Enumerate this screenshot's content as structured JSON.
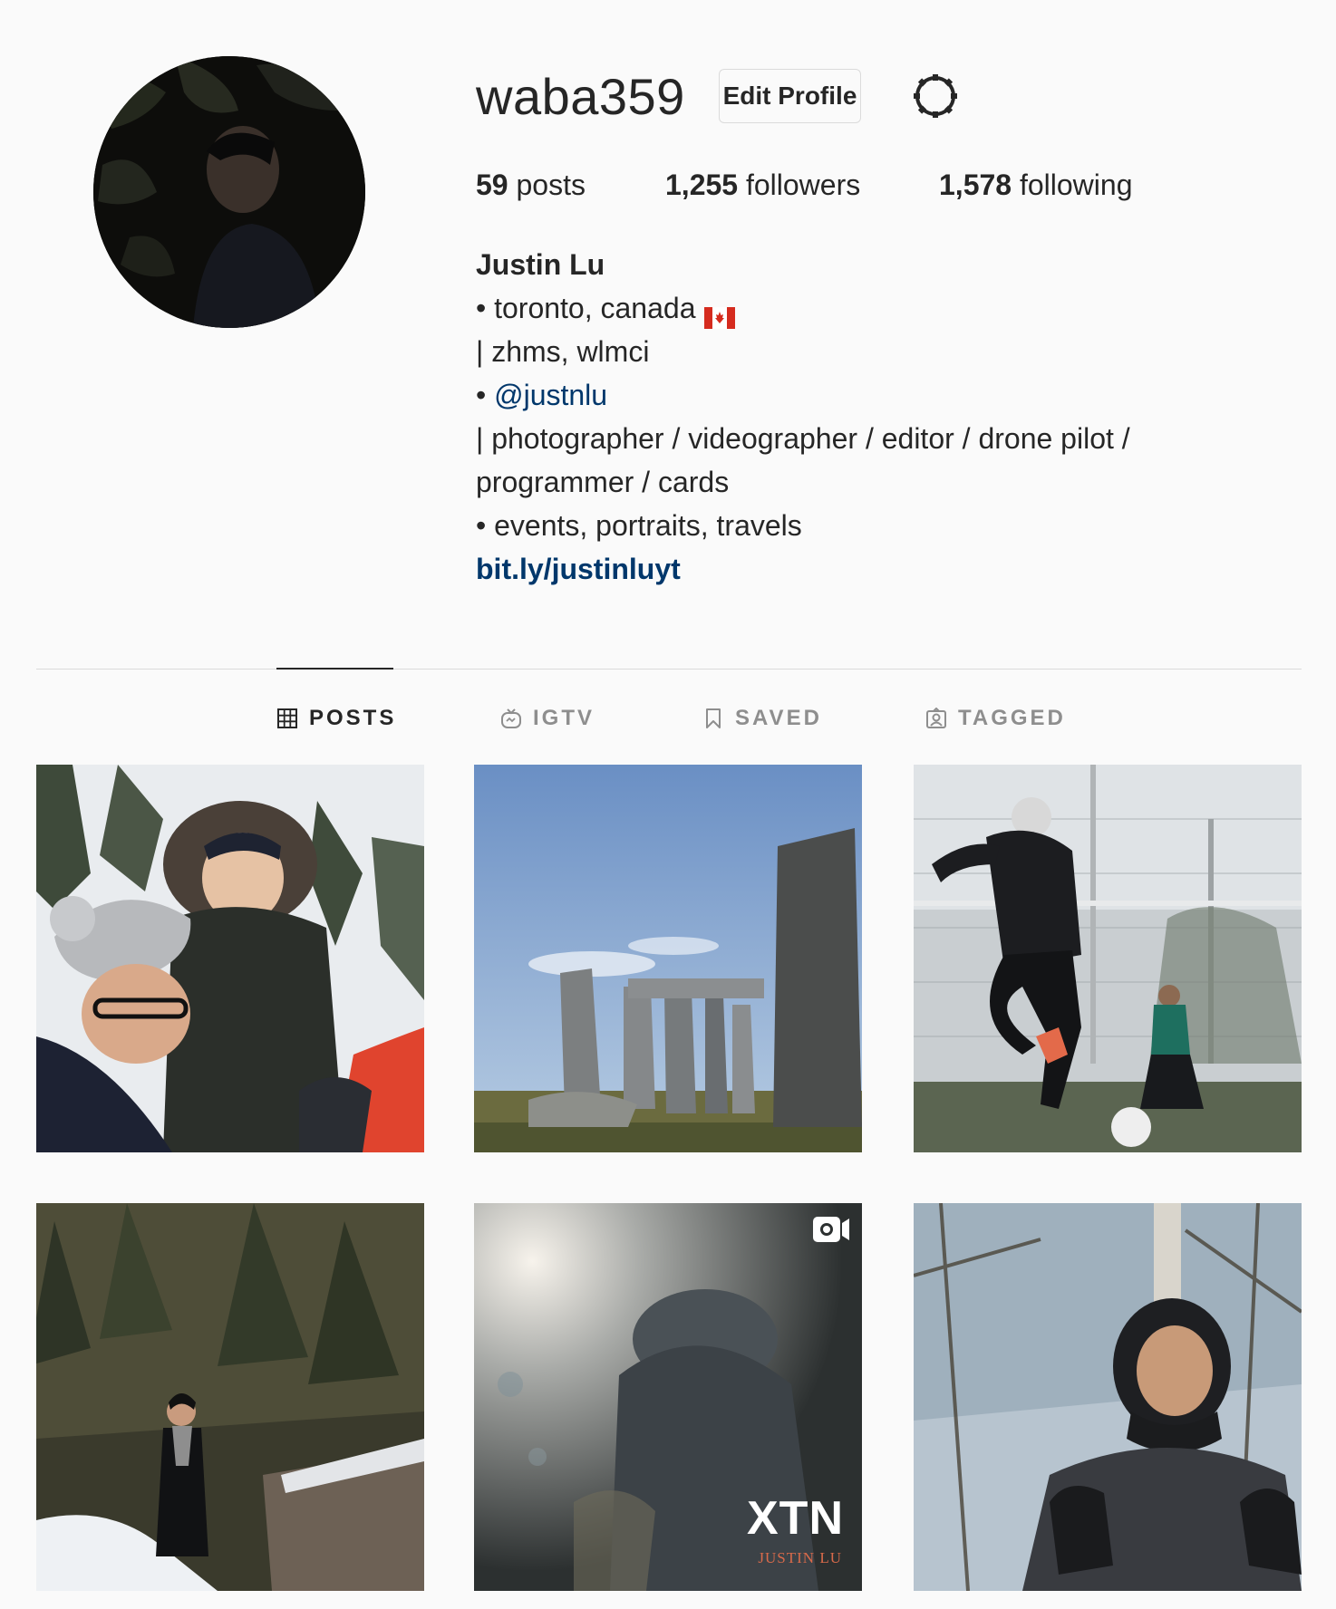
{
  "profile": {
    "username": "waba359",
    "edit_label": "Edit Profile",
    "stats": {
      "posts_num": "59",
      "posts_label": "posts",
      "followers_num": "1,255",
      "followers_label": "followers",
      "following_num": "1,578",
      "following_label": "following"
    },
    "bio": {
      "name": "Justin Lu",
      "line1": "• toronto, canada",
      "line2": "| zhms, wlmci",
      "line3_prefix": "• ",
      "mention": "@justnlu",
      "line4": "| photographer / videographer / editor / drone pilot /",
      "line5": "programmer / cards",
      "line6": "• events, portraits, travels",
      "link": "bit.ly/justinluyt"
    }
  },
  "tabs": [
    {
      "label": "POSTS",
      "icon": "grid-icon",
      "active": true
    },
    {
      "label": "IGTV",
      "icon": "igtv-icon",
      "active": false
    },
    {
      "label": "SAVED",
      "icon": "bookmark-icon",
      "active": false
    },
    {
      "label": "TAGGED",
      "icon": "tagged-icon",
      "active": false
    }
  ],
  "posts": {
    "video_overlay_title": "XTN",
    "video_overlay_subtitle": "JUSTIN LU"
  },
  "colors": {
    "background": "#fafafa",
    "text": "#262626",
    "muted": "#8e8e8e",
    "link": "#00376b",
    "border": "#dbdbdb"
  }
}
